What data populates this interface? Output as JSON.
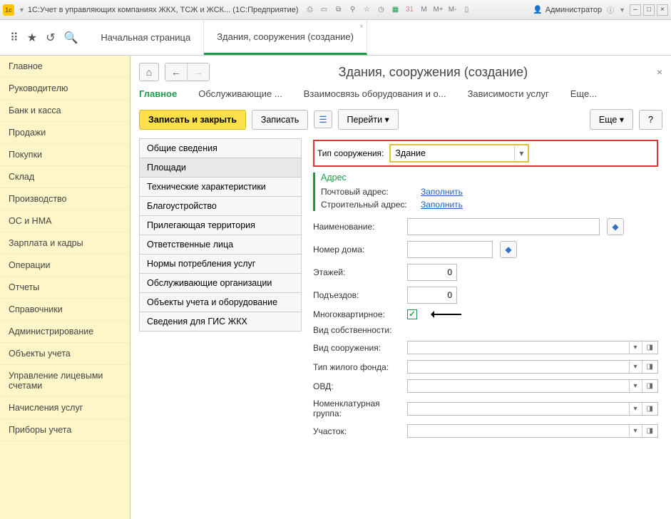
{
  "titlebar": {
    "title": "1С:Учет в управляющих компаниях ЖКХ, ТСЖ и ЖСК... (1С:Предприятие)",
    "user": "Администратор"
  },
  "topTabs": {
    "home": "Начальная страница",
    "active": "Здания, сооружения (создание)"
  },
  "sidebar": {
    "items": [
      "Главное",
      "Руководителю",
      "Банк и касса",
      "Продажи",
      "Покупки",
      "Склад",
      "Производство",
      "ОС и НМА",
      "Зарплата и кадры",
      "Операции",
      "Отчеты",
      "Справочники",
      "Администрирование",
      "Объекты учета",
      "Управление лицевыми счетами",
      "Начисления услуг",
      "Приборы учета"
    ]
  },
  "page": {
    "title": "Здания, сооружения (создание)"
  },
  "subnav": {
    "main": "Главное",
    "serving": "Обслуживающие ...",
    "relations": "Взаимосвязь оборудования и о...",
    "deps": "Зависимости услуг",
    "more": "Еще..."
  },
  "cmd": {
    "saveClose": "Записать и закрыть",
    "save": "Записать",
    "goto": "Перейти ▾",
    "more": "Еще ▾",
    "help": "?"
  },
  "sections": [
    "Общие сведения",
    "Площади",
    "Технические характеристики",
    "Благоустройство",
    "Прилегающая территория",
    "Ответственные лица",
    "Нормы потребления услуг",
    "Обслуживающие организации",
    "Объекты учета и оборудование",
    "Сведения для ГИС ЖКХ"
  ],
  "form": {
    "typeLabel": "Тип сооружения:",
    "typeValue": "Здание",
    "addressGroup": "Адрес",
    "mailAddr": "Почтовый адрес:",
    "buildAddr": "Строительный адрес:",
    "fill": "Заполнить",
    "name": "Наименование:",
    "houseNo": "Номер дома:",
    "floors": "Этажей:",
    "floorsVal": "0",
    "entrances": "Подъездов:",
    "entrancesVal": "0",
    "multi": "Многоквартирное:",
    "ownership": "Вид собственности:",
    "buildingKind": "Вид сооружения:",
    "housingFund": "Тип жилого фонда:",
    "ovd": "ОВД:",
    "nomGroup": "Номенклатурная группа:",
    "plot": "Участок:"
  }
}
